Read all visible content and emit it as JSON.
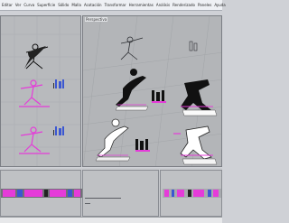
{
  "menubar": {
    "items": [
      "Editar",
      "Ver",
      "Curva",
      "Superficie",
      "Sólido",
      "Malla",
      "Acotación",
      "Transformar",
      "Herramientas",
      "Análisis",
      "Renderizado",
      "Paneles",
      "Ayuda"
    ]
  },
  "viewports": {
    "left_title": "",
    "right_title": "Perspectiva"
  },
  "colors": {
    "accent_magenta": "#e53bd9",
    "accent_blue": "#3b57d1",
    "wire_dark": "#2d2f33"
  }
}
